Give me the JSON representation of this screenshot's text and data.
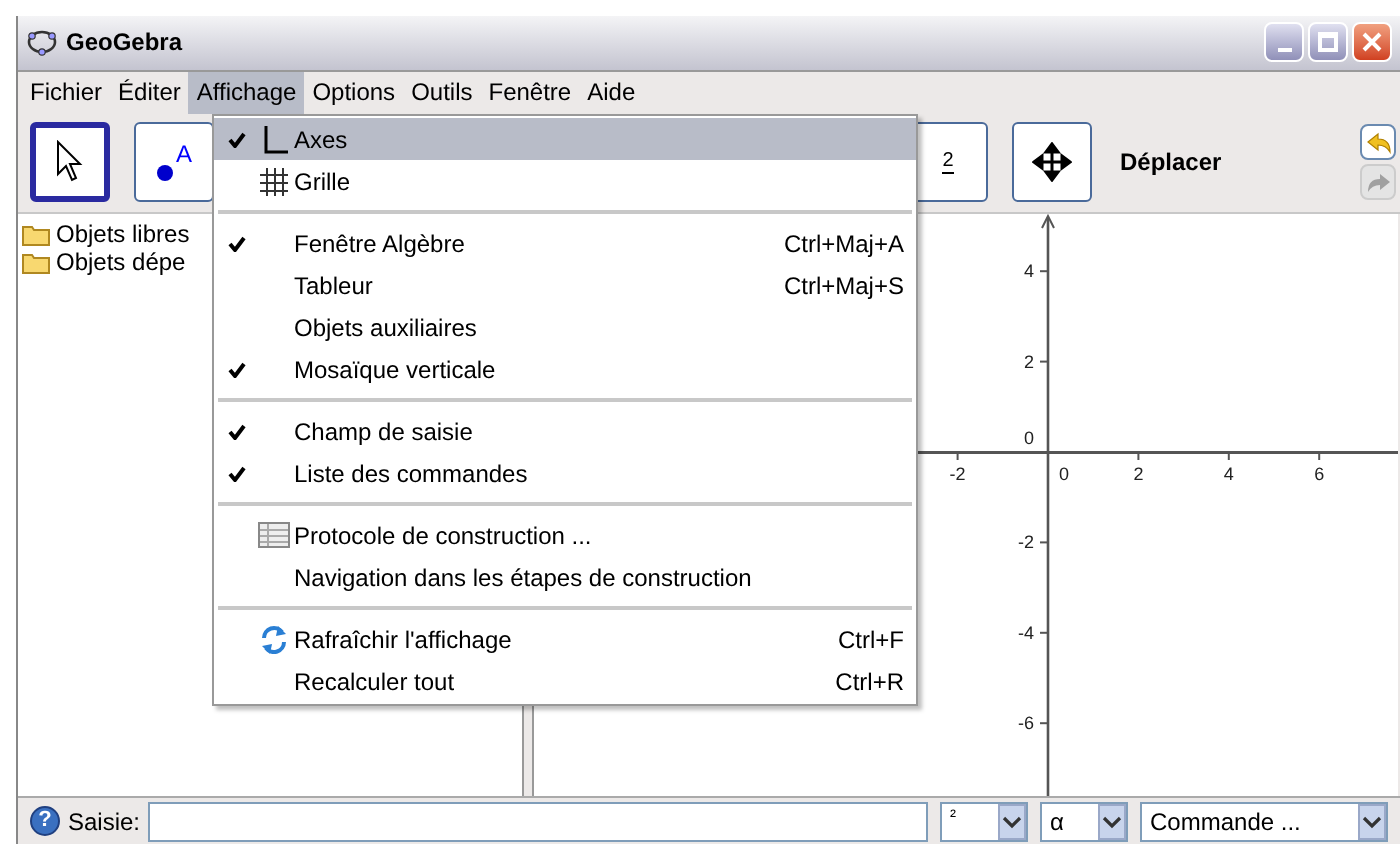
{
  "window": {
    "title": "GeoGebra"
  },
  "menu_bar": [
    {
      "label": "Fichier",
      "selected": false
    },
    {
      "label": "Éditer",
      "selected": false
    },
    {
      "label": "Affichage",
      "selected": true
    },
    {
      "label": "Options",
      "selected": false
    },
    {
      "label": "Outils",
      "selected": false
    },
    {
      "label": "Fenêtre",
      "selected": false
    },
    {
      "label": "Aide",
      "selected": false
    }
  ],
  "toolbar": {
    "tools": [
      {
        "kind": "select",
        "selected": true
      },
      {
        "kind": "point",
        "label": "A",
        "selected": false
      },
      {
        "kind": "slider",
        "label": "2",
        "selected": false
      },
      {
        "kind": "move",
        "selected": false
      }
    ],
    "tool_name": "Déplacer"
  },
  "algebra": {
    "items": [
      {
        "label": "Objets libres"
      },
      {
        "label": "Objets dépe"
      }
    ]
  },
  "menu": {
    "items": [
      {
        "kind": "axes",
        "label": "Axes",
        "checked": true,
        "selected": true
      },
      {
        "kind": "grid",
        "label": "Grille",
        "checked": false,
        "selected": false
      },
      {
        "kind": "separator"
      },
      {
        "kind": "item",
        "label": "Fenêtre Algèbre",
        "checked": true,
        "shortcut": "Ctrl+Maj+A",
        "selected": false
      },
      {
        "kind": "item",
        "label": "Tableur",
        "checked": false,
        "shortcut": "Ctrl+Maj+S",
        "selected": false
      },
      {
        "kind": "item",
        "label": "Objets auxiliaires",
        "checked": false,
        "selected": false
      },
      {
        "kind": "item",
        "label": "Mosaïque verticale",
        "checked": true,
        "selected": false
      },
      {
        "kind": "separator"
      },
      {
        "kind": "item",
        "label": "Champ de saisie",
        "checked": true,
        "selected": false
      },
      {
        "kind": "item",
        "label": "Liste des commandes",
        "checked": true,
        "selected": false
      },
      {
        "kind": "separator"
      },
      {
        "kind": "table",
        "label": "Protocole de construction ...",
        "checked": false,
        "selected": false
      },
      {
        "kind": "item",
        "label": "Navigation dans les étapes de construction",
        "checked": false,
        "selected": false
      },
      {
        "kind": "separator"
      },
      {
        "kind": "refresh",
        "label": "Rafraîchir l'affichage",
        "checked": false,
        "shortcut": "Ctrl+F",
        "selected": false
      },
      {
        "kind": "item",
        "label": "Recalculer tout",
        "checked": false,
        "shortcut": "Ctrl+R",
        "selected": false
      }
    ]
  },
  "graphics": {
    "x_tick_labels": [
      "-2",
      "0",
      "2",
      "4",
      "6"
    ],
    "y_tick_labels": [
      "4",
      "2",
      "0",
      "-2",
      "-4",
      "-6"
    ]
  },
  "input_bar": {
    "help": "?",
    "label": "Saisie:",
    "dropdowns": [
      {
        "value": "²"
      },
      {
        "value": "α"
      },
      {
        "value": "Commande ..."
      }
    ]
  }
}
